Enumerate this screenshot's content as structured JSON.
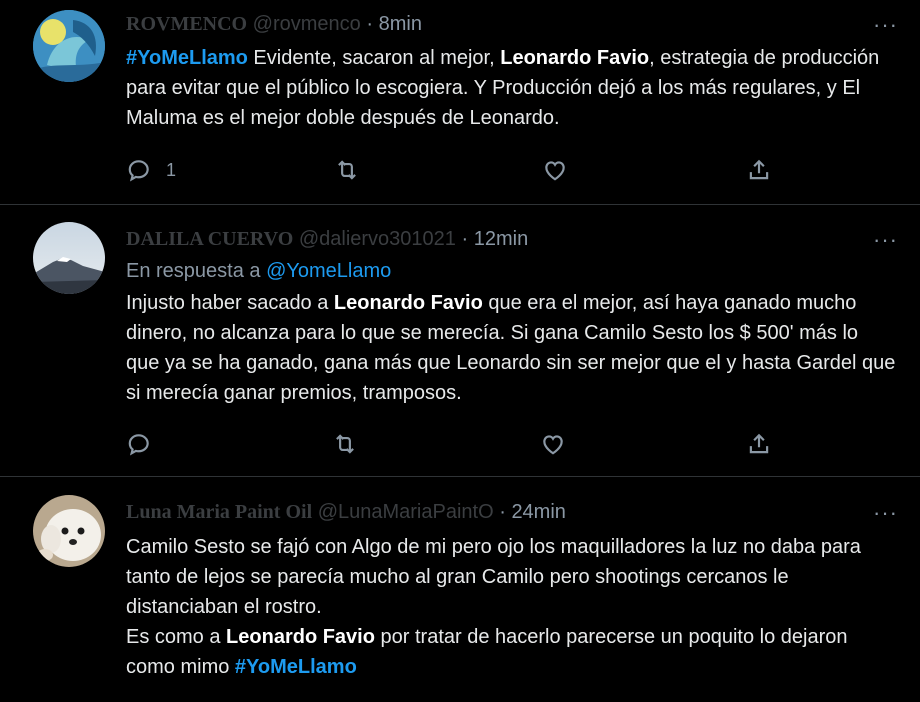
{
  "tweets": [
    {
      "name": "ROVMENCO",
      "handle": "@rovmenco",
      "dot": "·",
      "time": "8min",
      "more": "···",
      "body": {
        "p1": "#YoMeLlamo",
        "p2": " Evidente, sacaron al mejor, ",
        "p3": "Leonardo Favio",
        "p4": ", estrategia de producción para evitar que el público lo escogiera. Y Producción dejó a los más regulares, y El Maluma es el mejor doble después de Leonardo."
      },
      "reply_count": "1"
    },
    {
      "name": "DALILA CUERVO",
      "handle": "@daliervo301021",
      "dot": "·",
      "time": "12min",
      "more": "···",
      "reply_prefix": "En respuesta a ",
      "reply_mention": "@YomeLlamo",
      "body": {
        "p1": "Injusto haber sacado a ",
        "p2": "Leonardo Favio",
        "p3": " que era el mejor, así haya ganado mucho dinero, no alcanza para lo que se merecía. Si gana Camilo Sesto los $ 500' más lo que ya se ha ganado, gana más que Leonardo sin ser mejor que el y hasta Gardel que si merecía ganar premios, tramposos."
      }
    },
    {
      "name": "Luna Maria Paint Oil",
      "handle": "@LunaMariaPaintO",
      "dot": "·",
      "time": "24min",
      "more": "···",
      "body": {
        "line1": "Camilo Sesto se fajó con Algo de mi pero ojo los maquilladores la luz no daba para tanto de lejos se parecía mucho al gran Camilo pero shootings cercanos le distanciaban el rostro.",
        "l2a": "Es como a ",
        "l2b": "Leonardo Favio",
        "l2c": " por tratar de hacerlo parecerse un poquito lo dejaron como mimo ",
        "l2d": "#YoMeLlamo"
      }
    }
  ],
  "icons": {
    "reply": "reply-icon",
    "retweet": "retweet-icon",
    "like": "like-icon",
    "share": "share-icon"
  },
  "colors": {
    "background": "#000000",
    "text": "#e7e9ea",
    "muted": "#8b98a5",
    "link": "#1d9bf0",
    "divider": "#2f3336"
  }
}
